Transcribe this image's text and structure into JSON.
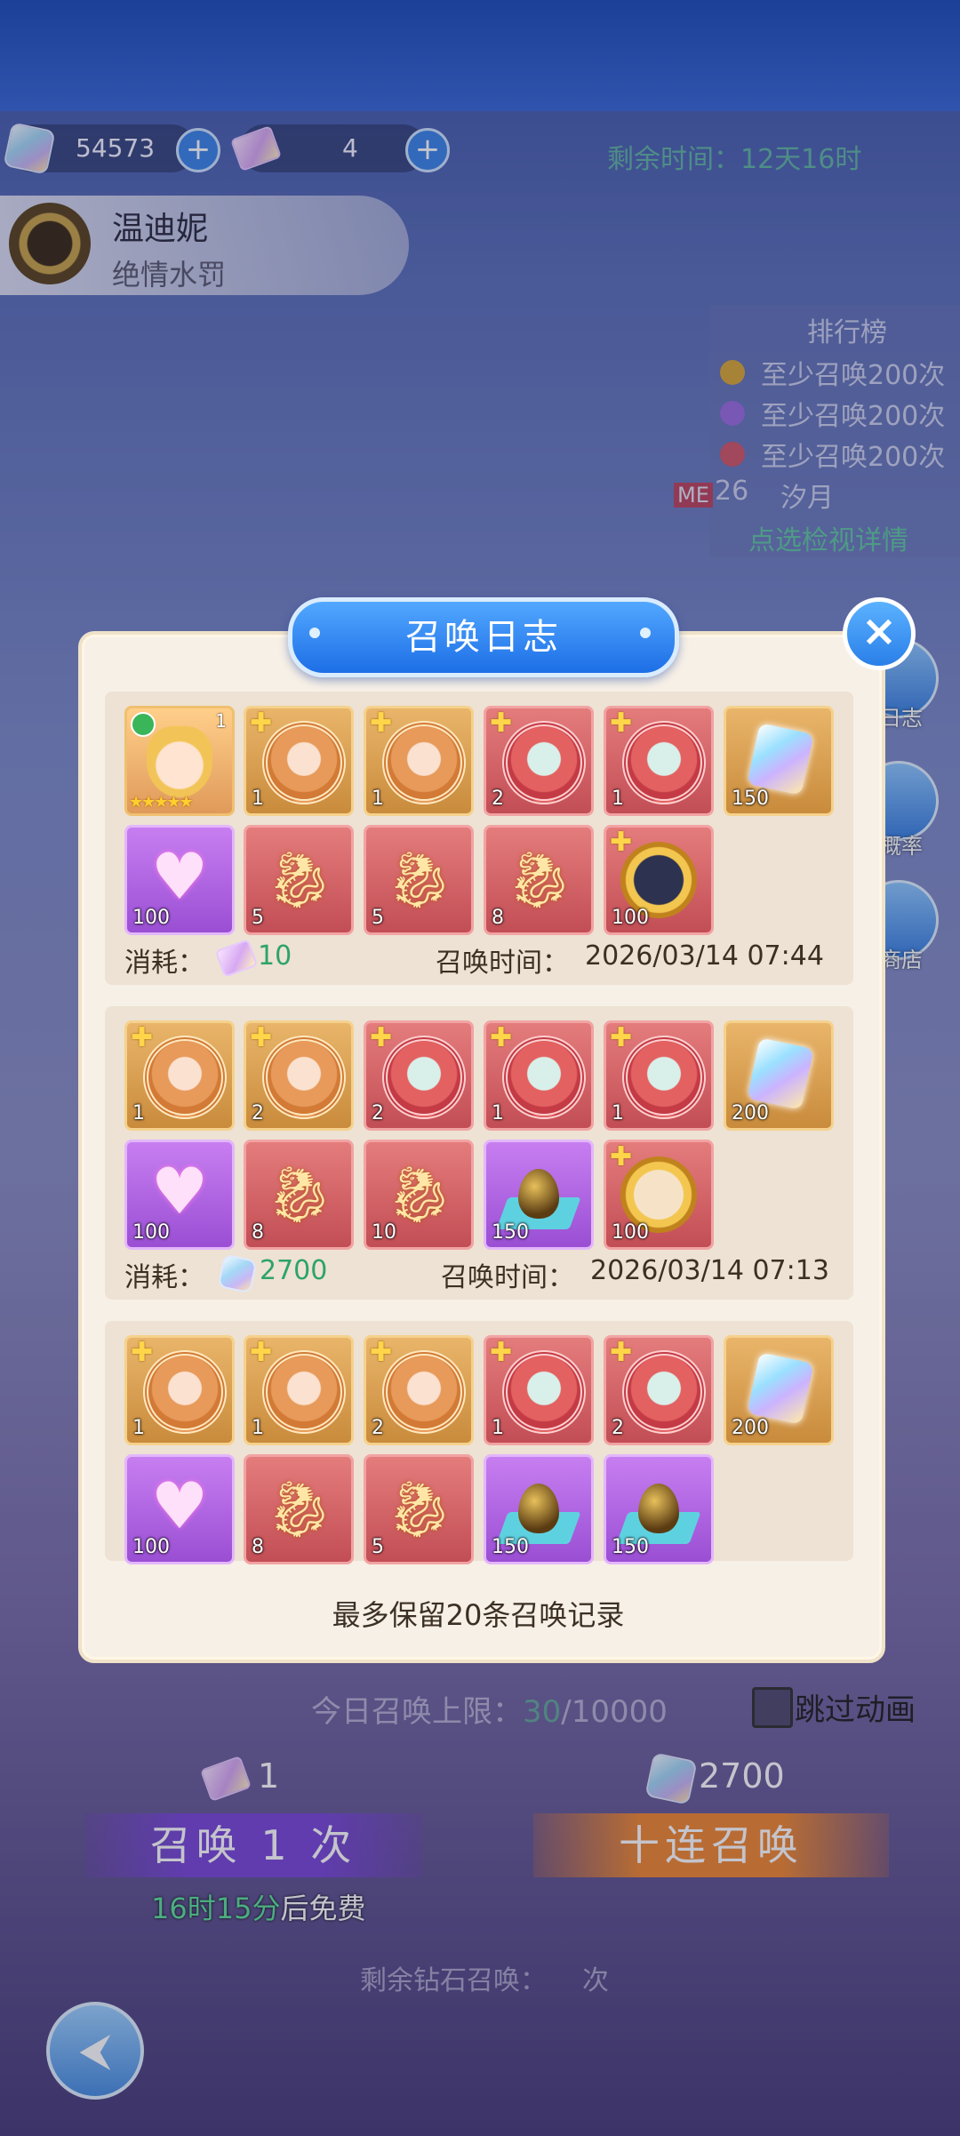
{
  "top": {
    "diamonds": "54573",
    "scrolls": "4",
    "timer": "剩余时间：12天16时"
  },
  "hero": {
    "name": "温迪妮",
    "subtitle": "绝情水罚"
  },
  "ranking": {
    "title": "排行榜",
    "entries": [
      "至少召唤200次",
      "至少召唤200次",
      "至少召唤200次"
    ],
    "me_badge": "ME",
    "me_rank": "26",
    "me_name": "汐月",
    "detail_link": "点选检视详情"
  },
  "side": {
    "log": "日志",
    "rate": "概率",
    "shop": "商店"
  },
  "modal": {
    "title": "召唤日志",
    "close": "×",
    "records": [
      {
        "row1": [
          {
            "type": "portrait",
            "count": "1",
            "stars": "★★★★★"
          },
          {
            "type": "gold",
            "count": "1"
          },
          {
            "type": "gold",
            "count": "1"
          },
          {
            "type": "red",
            "count": "2"
          },
          {
            "type": "red",
            "count": "1"
          },
          {
            "type": "crystal",
            "count": "150"
          }
        ],
        "row2": [
          {
            "type": "heart",
            "count": "100"
          },
          {
            "type": "dragon",
            "count": "5"
          },
          {
            "type": "dragon",
            "count": "5"
          },
          {
            "type": "dragon",
            "count": "8"
          },
          {
            "type": "medallion",
            "count": "100"
          }
        ],
        "cost_label": "消耗：",
        "cost": "10",
        "time_label": "召唤时间：",
        "time": "2026/03/14 07:44"
      },
      {
        "row1": [
          {
            "type": "gold",
            "count": "1"
          },
          {
            "type": "gold",
            "count": "2"
          },
          {
            "type": "red",
            "count": "2"
          },
          {
            "type": "red",
            "count": "1"
          },
          {
            "type": "red",
            "count": "1"
          },
          {
            "type": "crystal",
            "count": "200"
          }
        ],
        "row2": [
          {
            "type": "heart",
            "count": "100"
          },
          {
            "type": "dragon",
            "count": "8"
          },
          {
            "type": "dragon",
            "count": "10"
          },
          {
            "type": "egg",
            "count": "150"
          },
          {
            "type": "medallion",
            "count": "100"
          }
        ],
        "cost_label": "消耗：",
        "cost": "2700",
        "time_label": "召唤时间：",
        "time": "2026/03/14 07:13"
      },
      {
        "row1": [
          {
            "type": "gold",
            "count": "1"
          },
          {
            "type": "gold",
            "count": "1"
          },
          {
            "type": "gold",
            "count": "2"
          },
          {
            "type": "red",
            "count": "1"
          },
          {
            "type": "red",
            "count": "2"
          },
          {
            "type": "crystal",
            "count": "200"
          }
        ],
        "row2": [
          {
            "type": "heart",
            "count": "100"
          },
          {
            "type": "dragon",
            "count": "8"
          },
          {
            "type": "dragon",
            "count": "5"
          },
          {
            "type": "egg",
            "count": "150"
          },
          {
            "type": "egg",
            "count": "150"
          }
        ]
      }
    ],
    "footer": "最多保留20条召唤记录"
  },
  "bottom": {
    "limit_prefix": "今日召唤上限：",
    "limit_used": "30",
    "limit_total": "/10000",
    "skip": "跳过动画",
    "cost1": "1",
    "cost10": "2700",
    "btn1": "召唤 1 次",
    "btn10": "十连召唤",
    "free_time": "16时15分",
    "free_suffix": "后免费",
    "remain_prefix": "剩余钻石召唤：",
    "remain_suffix": "次",
    "back": "⮜"
  }
}
